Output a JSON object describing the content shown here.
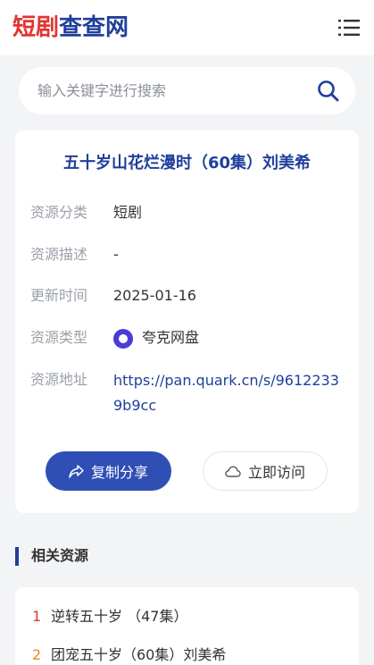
{
  "header": {
    "logo_part1": "短剧",
    "logo_part2": "查查网",
    "menu_icon": "hamburger-menu-icon"
  },
  "search": {
    "placeholder": "输入关键字进行搜索",
    "icon": "search-icon",
    "accent": "#1f3f9c"
  },
  "resource": {
    "title": "五十岁山花烂漫时（60集）刘美希",
    "category_label": "资源分类",
    "category_value": "短剧",
    "desc_label": "资源描述",
    "desc_value": "-",
    "updated_label": "更新时间",
    "updated_value": "2025-01-16",
    "type_label": "资源类型",
    "type_value": "夸克网盘",
    "address_label": "资源地址",
    "address_value": "https://pan.quark.cn/s/96122339b9cc"
  },
  "actions": {
    "share_label": "复制分享",
    "visit_label": "立即访问",
    "share_color": "#2f4fb5"
  },
  "related": {
    "section_title": "相关资源",
    "items": [
      {
        "rank": "1",
        "title": "逆转五十岁 （47集）"
      },
      {
        "rank": "2",
        "title": "团宠五十岁（60集）刘美希"
      }
    ]
  }
}
